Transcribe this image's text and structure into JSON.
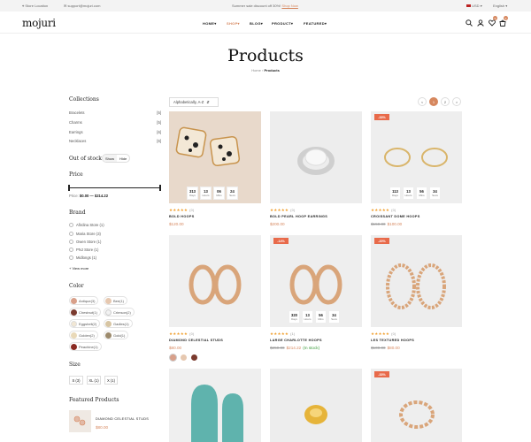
{
  "topbar": {
    "store_location": "Store Location",
    "email": "support@mojuri.com",
    "promo_text": "Summer sale discount off 30%!",
    "promo_link": "Shop Now",
    "currency": "USD",
    "language": "English"
  },
  "header": {
    "logo": "mojuri",
    "nav": [
      "HOME",
      "SHOP",
      "BLOG",
      "PRODUCT",
      "FEATURED"
    ],
    "wishlist_count": "0",
    "cart_count": "0"
  },
  "page": {
    "title": "Products",
    "breadcrumb_home": "Home",
    "breadcrumb_current": "Products"
  },
  "sidebar": {
    "collections_title": "Collections",
    "collections": [
      {
        "name": "Bracelets",
        "count": "[5]"
      },
      {
        "name": "Charms",
        "count": "[5]"
      },
      {
        "name": "Earrings",
        "count": "[6]"
      },
      {
        "name": "Necklaces",
        "count": "[6]"
      }
    ],
    "stock_title": "Out of stock",
    "stock_show": "Show",
    "stock_hide": "Hide",
    "price_title": "Price",
    "price_label": "Price:",
    "price_range": "$0.00 — $214.22",
    "brand_title": "Brand",
    "brands": [
      "Afirdina Store (1)",
      "Maria Store (3)",
      "Owen Store (1)",
      "PNJ Store (1)",
      "Midlongs (1)"
    ],
    "view_more": "+ View more",
    "color_title": "Color",
    "colors": [
      {
        "name": "Antique(3)",
        "hex": "#d8a08a"
      },
      {
        "name": "Bee(1)",
        "hex": "#e6c8b0"
      },
      {
        "name": "Chestnut(1)",
        "hex": "#7a3a2e"
      },
      {
        "name": "Crimson(2)",
        "hex": "#f2f2f2"
      },
      {
        "name": "Eggshell(2)",
        "hex": "#f1e7d4"
      },
      {
        "name": "Gadles(1)",
        "hex": "#d7c5a3"
      },
      {
        "name": "Golden(2)",
        "hex": "#e9d9b8"
      },
      {
        "name": "Gold(1)",
        "hex": "#9c8a6c"
      },
      {
        "name": "Peachine(1)",
        "hex": "#8a2a22"
      }
    ],
    "size_title": "Size",
    "sizes": [
      "S (3)",
      "XL (1)",
      "X (1)"
    ],
    "featured_title": "Featured Products",
    "featured_name": "DIAMOND CELESTIAL STUDS",
    "featured_price": "$80.00"
  },
  "toolbar": {
    "sort_label": "Alphabetically, A-Z",
    "pages": [
      "<",
      "1",
      "2",
      ">"
    ],
    "active_page": "1"
  },
  "countdown_units": [
    "Days",
    "Hours",
    "Mins",
    "Secs"
  ],
  "products": [
    {
      "name": "BOLD HOOPS",
      "reviews": "(0)",
      "price": "$120.00",
      "old_price": "",
      "stock": "",
      "badge": "",
      "countdown": [
        "313",
        "13",
        "06",
        "24"
      ],
      "swatches": []
    },
    {
      "name": "BOLD PEARL HOOP EARRINGS",
      "reviews": "(0)",
      "price": "$200.00",
      "old_price": "",
      "stock": "",
      "badge": "",
      "countdown": [],
      "swatches": []
    },
    {
      "name": "CROISSANT DOME HOOPS",
      "reviews": "(0)",
      "price": "$100.00",
      "old_price": "$150.00",
      "stock": "",
      "badge": "-33%",
      "countdown": [
        "113",
        "13",
        "56",
        "34"
      ],
      "swatches": []
    },
    {
      "name": "DIAMOND CELESTIAL STUDS",
      "reviews": "(0)",
      "price": "$80.00",
      "old_price": "",
      "stock": "",
      "badge": "",
      "countdown": [],
      "swatches": [
        "#d8a08a",
        "#e6c8b0",
        "#7a3a2e"
      ]
    },
    {
      "name": "LARGE CHARLOTTE HOOPS",
      "reviews": "(1)",
      "price": "$214.22",
      "old_price": "$250.00",
      "stock": "(In stock)",
      "badge": "-14%",
      "countdown": [
        "320",
        "13",
        "56",
        "34"
      ],
      "swatches": []
    },
    {
      "name": "LES TEXTURED HOOPS",
      "reviews": "(0)",
      "price": "$80.00",
      "old_price": "$100.00",
      "stock": "",
      "badge": "-20%",
      "countdown": [],
      "swatches": []
    },
    {
      "name": "",
      "reviews": "",
      "price": "",
      "old_price": "",
      "stock": "",
      "badge": "",
      "countdown": [],
      "swatches": []
    },
    {
      "name": "",
      "reviews": "",
      "price": "",
      "old_price": "",
      "stock": "",
      "badge": "",
      "countdown": [],
      "swatches": []
    },
    {
      "name": "",
      "reviews": "",
      "price": "",
      "old_price": "",
      "stock": "-33%",
      "badge": "-33%",
      "countdown": [],
      "swatches": []
    }
  ]
}
